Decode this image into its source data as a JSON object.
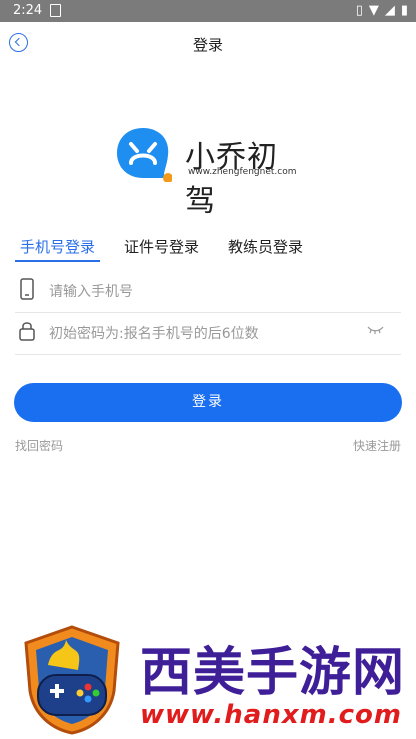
{
  "status": {
    "time": "2:24"
  },
  "header": {
    "title": "登录"
  },
  "logo": {
    "name": "小乔初驾",
    "url": "www.zhengfengnet.com"
  },
  "tabs": [
    {
      "label": "手机号登录"
    },
    {
      "label": "证件号登录"
    },
    {
      "label": "教练员登录"
    }
  ],
  "form": {
    "phone_placeholder": "请输入手机号",
    "password_placeholder": "初始密码为:报名手机号的后6位数",
    "login_label": "登录"
  },
  "links": {
    "forgot": "找回密码",
    "register": "快速注册"
  },
  "watermark": {
    "title": "西美手游网",
    "url": "www.hanxm.com"
  },
  "colors": {
    "accent": "#1a6ef0",
    "statusbar": "#7b7b7b"
  }
}
